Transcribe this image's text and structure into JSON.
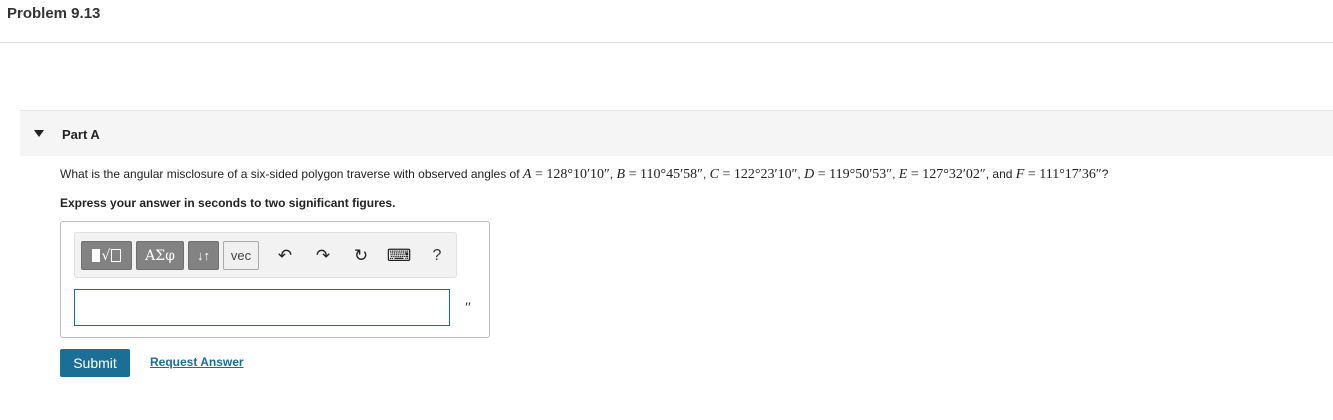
{
  "page": {
    "title": "Problem 9.13"
  },
  "part": {
    "label": "Part A"
  },
  "question": {
    "lead": "What is the angular misclosure of a six-sided polygon traverse with observed angles of ",
    "angles": [
      {
        "var": "A",
        "value": "128°10′10″"
      },
      {
        "var": "B",
        "value": "110°45′58″"
      },
      {
        "var": "C",
        "value": "122°23′10″"
      },
      {
        "var": "D",
        "value": "119°50′53″"
      },
      {
        "var": "E",
        "value": "127°32′02″"
      },
      {
        "var": "F",
        "value": "111°17′36″"
      }
    ],
    "sep": ", ",
    "and": ", and ",
    "eq": " = ",
    "end": "?"
  },
  "instruction": "Express your answer in seconds to two significant figures.",
  "toolbar": {
    "templates_glyph": "√",
    "greek_label": "ΑΣφ",
    "arrows_label": "↓↑",
    "vec_label": "vec",
    "undo_glyph": "↶",
    "redo_glyph": "↷",
    "reset_glyph": "↻",
    "keyboard_glyph": "⌨",
    "help_label": "?"
  },
  "answer": {
    "value": "",
    "unit": "″"
  },
  "actions": {
    "submit_label": "Submit",
    "request_label": "Request Answer"
  },
  "colors": {
    "accent": "#1b6e96",
    "toolbar_button": "#828282"
  }
}
